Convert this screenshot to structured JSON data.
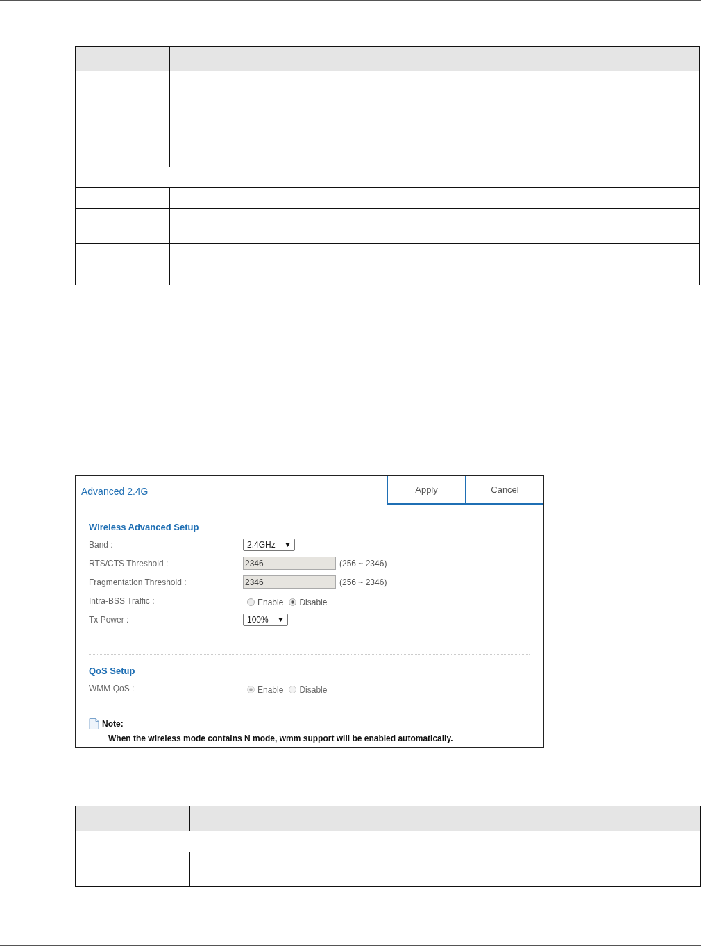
{
  "top_table": {
    "rows": [
      {
        "kind": "header"
      },
      {
        "kind": "tall"
      },
      {
        "kind": "span"
      },
      {
        "kind": "single"
      },
      {
        "kind": "double"
      },
      {
        "kind": "single"
      },
      {
        "kind": "single"
      }
    ]
  },
  "panel": {
    "title": "Advanced 2.4G",
    "buttons": [
      "Apply",
      "Cancel"
    ],
    "sections": [
      {
        "title": "Wireless Advanced Setup",
        "fields": [
          {
            "kind": "select",
            "label": "Band :",
            "value": "2.4GHz"
          },
          {
            "kind": "input",
            "label": "RTS/CTS Threshold :",
            "value": "2346",
            "range": "(256 ~ 2346)"
          },
          {
            "kind": "input",
            "label": "Fragmentation Threshold :",
            "value": "2346",
            "range": "(256 ~ 2346)"
          },
          {
            "kind": "radio",
            "label": "Intra-BSS Traffic :",
            "disabled": false,
            "options": [
              {
                "label": "Enable",
                "selected": false
              },
              {
                "label": "Disable",
                "selected": true
              }
            ]
          },
          {
            "kind": "select",
            "label": "Tx Power :",
            "value": "100%"
          }
        ]
      },
      {
        "title": "QoS Setup",
        "fields": [
          {
            "kind": "radio",
            "label": "WMM QoS :",
            "disabled": true,
            "options": [
              {
                "label": "Enable",
                "selected": true
              },
              {
                "label": "Disable",
                "selected": false
              }
            ]
          }
        ]
      }
    ],
    "note": {
      "title": "Note:",
      "text": "When the wireless mode contains N mode, wmm support will be enabled automatically."
    }
  },
  "bottom_table": {
    "rows": [
      {
        "kind": "header"
      },
      {
        "kind": "span"
      },
      {
        "kind": "double"
      }
    ]
  }
}
